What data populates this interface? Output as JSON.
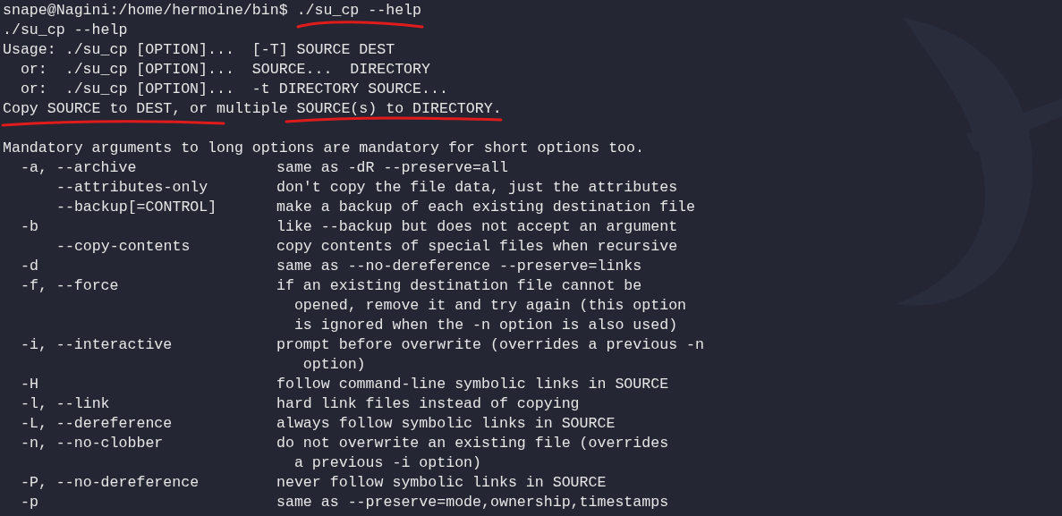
{
  "prompt": {
    "location": "snape@Nagini:/home/hermoine/bin$",
    "command": "./su_cp --help"
  },
  "output_lines": [
    "./su_cp --help",
    "Usage: ./su_cp [OPTION]...  [-T] SOURCE DEST",
    "  or:  ./su_cp [OPTION]...  SOURCE...  DIRECTORY",
    "  or:  ./su_cp [OPTION]...  -t DIRECTORY SOURCE...",
    "Copy SOURCE to DEST, or multiple SOURCE(s) to DIRECTORY."
  ],
  "note": "Mandatory arguments to long options are mandatory for short options too.",
  "options": [
    {
      "kind": "short",
      "flag": "-a, --archive",
      "description": [
        "same as -dR --preserve=all"
      ]
    },
    {
      "kind": "long",
      "flag": "--attributes-only",
      "description": [
        "don't copy the file data, just the attributes"
      ]
    },
    {
      "kind": "long",
      "flag": "--backup[=CONTROL]",
      "description": [
        "make a backup of each existing destination file"
      ]
    },
    {
      "kind": "short",
      "flag": "-b",
      "description": [
        "like --backup but does not accept an argument"
      ]
    },
    {
      "kind": "long",
      "flag": "--copy-contents",
      "description": [
        "copy contents of special files when recursive"
      ]
    },
    {
      "kind": "short",
      "flag": "-d",
      "description": [
        "same as --no-dereference --preserve=links"
      ]
    },
    {
      "kind": "short",
      "flag": "-f, --force",
      "description": [
        "if an existing destination file cannot be",
        "  opened, remove it and try again (this option",
        "  is ignored when the -n option is also used)"
      ]
    },
    {
      "kind": "short",
      "flag": "-i, --interactive",
      "description": [
        "prompt before overwrite (overrides a previous -n",
        "   option)"
      ]
    },
    {
      "kind": "short",
      "flag": "-H",
      "description": [
        "follow command-line symbolic links in SOURCE"
      ]
    },
    {
      "kind": "short",
      "flag": "-l, --link",
      "description": [
        "hard link files instead of copying"
      ]
    },
    {
      "kind": "short",
      "flag": "-L, --dereference",
      "description": [
        "always follow symbolic links in SOURCE"
      ]
    },
    {
      "kind": "short",
      "flag": "-n, --no-clobber",
      "description": [
        "do not overwrite an existing file (overrides",
        "  a previous -i option)"
      ]
    },
    {
      "kind": "short",
      "flag": "-P, --no-dereference",
      "description": [
        "never follow symbolic links in SOURCE"
      ]
    },
    {
      "kind": "short",
      "flag": "-p",
      "description": [
        "same as --preserve=mode,ownership,timestamps"
      ]
    }
  ]
}
